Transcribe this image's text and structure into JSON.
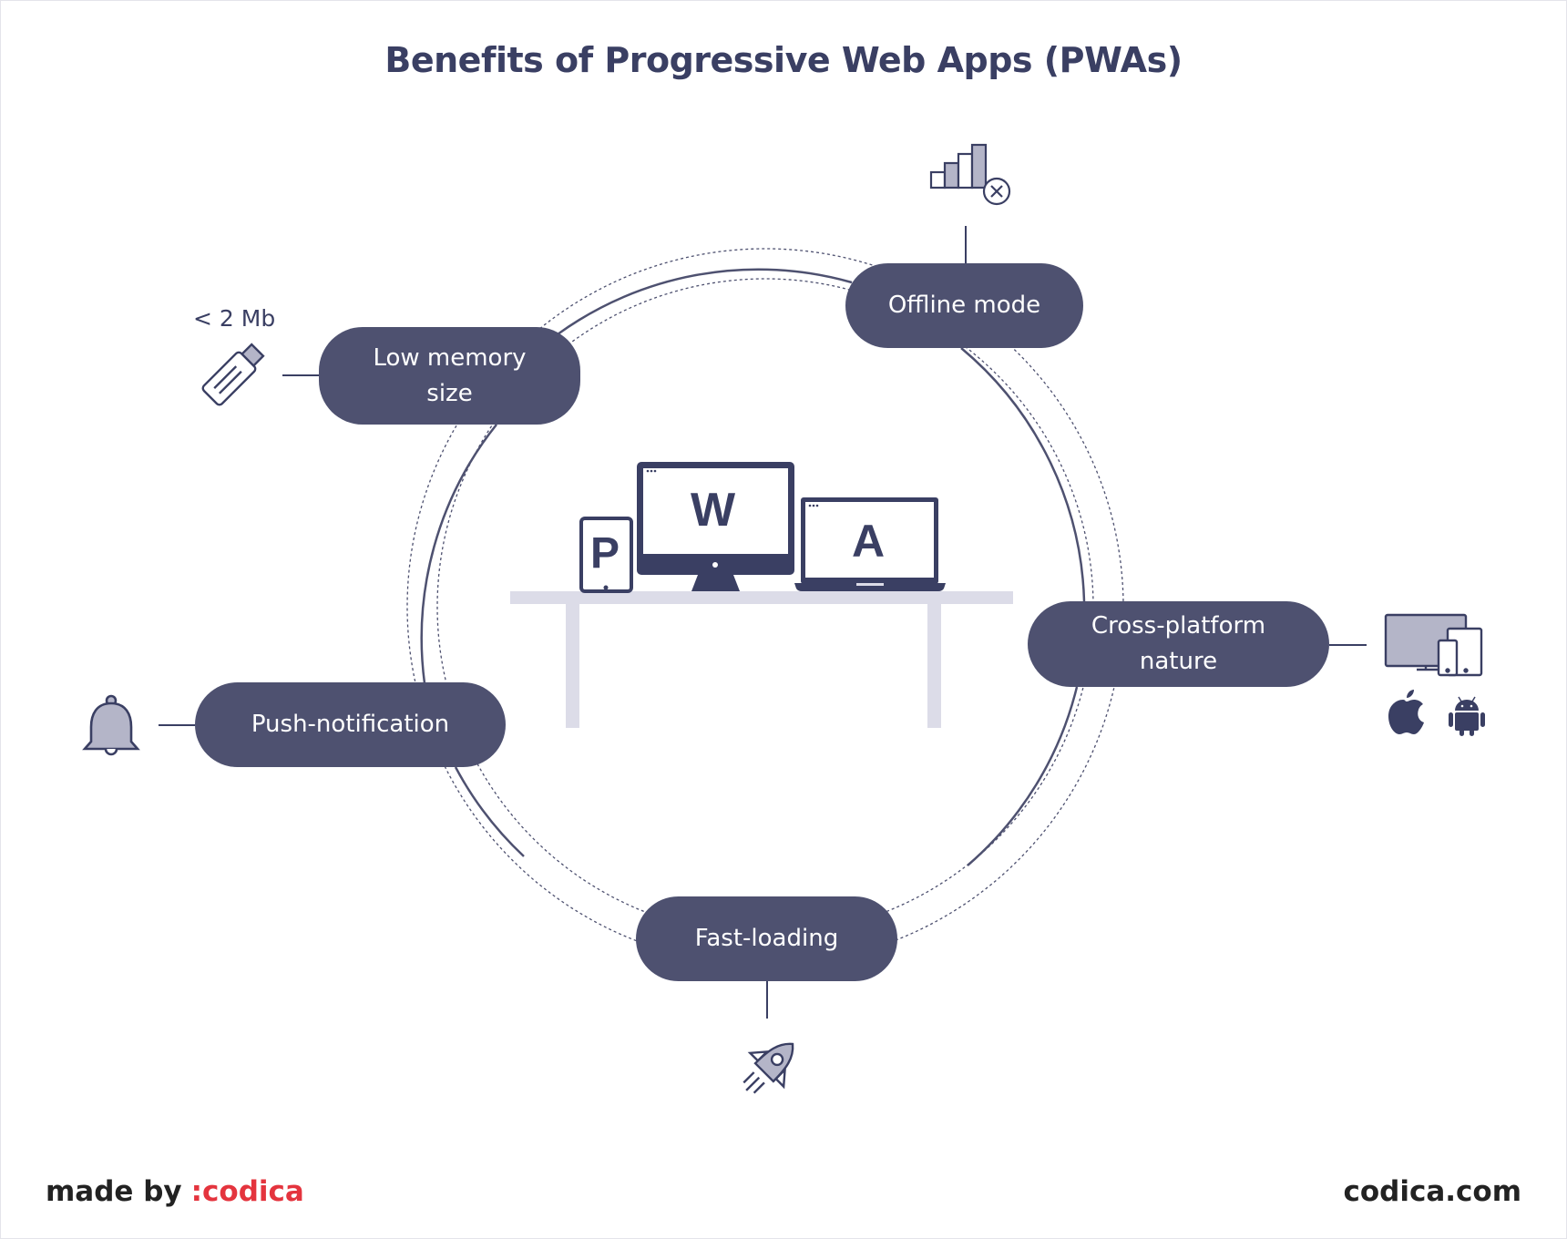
{
  "title": "Benefits of Progressive Web Apps (PWAs)",
  "colors": {
    "primary": "#3a3f63",
    "pill": "#4e5170",
    "icon_fill": "#b4b5c8",
    "table": "#dcdce8",
    "brand_red": "#e4343e"
  },
  "center": {
    "letters": [
      "P",
      "W",
      "A"
    ],
    "devices": [
      "tablet-icon",
      "desktop-monitor-icon",
      "laptop-icon"
    ]
  },
  "benefits": [
    {
      "id": "offline",
      "label": "Offline mode",
      "icon": "no-signal-icon"
    },
    {
      "id": "memory",
      "label": "Low memory size",
      "line1": "Low memory",
      "line2": "size",
      "icon": "usb-drive-icon",
      "note": "< 2 Mb"
    },
    {
      "id": "cross",
      "label": "Cross-platform nature",
      "line1": "Cross-platform",
      "line2": "nature",
      "icon": "multi-device-icon",
      "sub_icons": [
        "apple-icon",
        "android-icon"
      ]
    },
    {
      "id": "push",
      "label": "Push-notification",
      "icon": "bell-icon"
    },
    {
      "id": "fast",
      "label": "Fast-loading",
      "icon": "rocket-icon"
    }
  ],
  "footer": {
    "made_by": "made by",
    "brand": ":codica",
    "website": "codica.com"
  }
}
